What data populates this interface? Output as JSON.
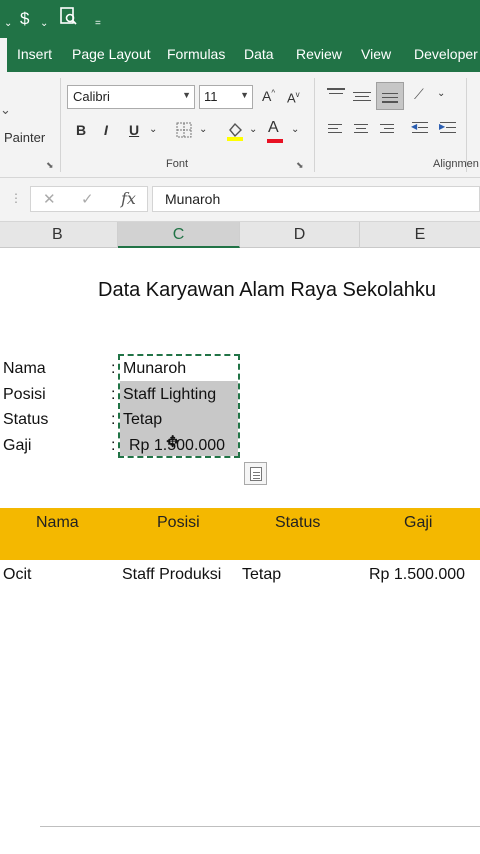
{
  "quick_access": {
    "dollar_icon": "$",
    "print_preview_icon": "print-preview-icon",
    "customize_icon": "customize-icon"
  },
  "tabs": [
    "Insert",
    "Page Layout",
    "Formulas",
    "Data",
    "Review",
    "View",
    "Developer"
  ],
  "ribbon": {
    "painter_label": "Painter",
    "font_name": "Calibri",
    "font_size": "11",
    "bold": "B",
    "italic": "I",
    "underline": "U",
    "font_group_label": "Font",
    "alignment_group_label": "Alignmen",
    "grow_font": "A",
    "shrink_font": "A",
    "font_color_letter": "A"
  },
  "formula_bar": {
    "cancel_icon": "✕",
    "enter_icon": "✓",
    "fx_label": "fx",
    "content": "Munaroh"
  },
  "columns": [
    "B",
    "C",
    "D",
    "E"
  ],
  "sheet": {
    "title": "Data Karyawan Alam Raya Sekolahku",
    "fields": [
      {
        "label": "Nama",
        "colon": ":",
        "value": "Munaroh"
      },
      {
        "label": "Posisi",
        "colon": ":",
        "value": "Staff Lighting"
      },
      {
        "label": "Status",
        "colon": ":",
        "value": "Tetap"
      },
      {
        "label": "Gaji",
        "colon": ":",
        "value": "Rp 1.500.000"
      }
    ],
    "table_headers": [
      "Nama",
      "Posisi",
      "Status",
      "Gaji"
    ],
    "table_rows": [
      {
        "nama": "Ocit",
        "posisi": "Staff Produksi",
        "status": "Tetap",
        "gaji": "Rp 1.500.000"
      }
    ]
  },
  "colors": {
    "excel_green": "#217346",
    "header_band": "#f4b800",
    "selection_fill": "#c8c8c8"
  }
}
